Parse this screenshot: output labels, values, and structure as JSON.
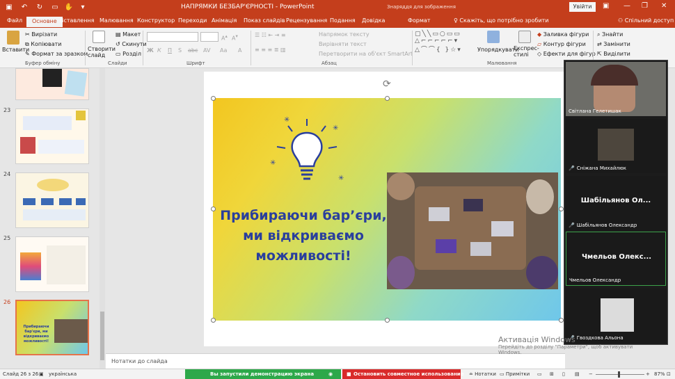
{
  "titlebar": {
    "doc_title": "НАПРЯМКИ БЕЗБАР'ЄРНОСТІ  -  PowerPoint",
    "tools_title": "Знаряддя для зображення",
    "signin": "Увійти"
  },
  "tabs": [
    "Файл",
    "Основне",
    "Вставлення",
    "Малювання",
    "Конструктор",
    "Переходи",
    "Анімація",
    "Показ слайдів",
    "Рецензування",
    "Подання",
    "Довідка",
    "Формат"
  ],
  "tellme": "Скажіть, що потрібно зробити",
  "share": "Спільний доступ",
  "ribbon": {
    "clipboard": {
      "paste": "Вставити",
      "cut": "Вирізати",
      "copy": "Копіювати",
      "format_painter": "Формат за зразком",
      "label": "Буфер обміну"
    },
    "slides": {
      "new_slide": "Створити слайд",
      "layout": "Макет",
      "reset": "Скинути",
      "section": "Розділ",
      "label": "Слайди"
    },
    "font": {
      "label": "Шрифт",
      "buttons": [
        "Ж",
        "К",
        "П",
        "S",
        "abc",
        "AV",
        "Aa",
        "A"
      ]
    },
    "paragraph": {
      "text_direction": "Напрямок тексту",
      "align_text": "Вирівняти текст",
      "smartart": "Перетворити на об'єкт SmartArt",
      "label": "Абзац"
    },
    "drawing": {
      "arrange": "Упорядкувати",
      "quick_styles": "Експрес-стилі",
      "fill": "Заливка фігури",
      "outline": "Контур фігури",
      "effects": "Ефекти для фігур",
      "label": "Малювання"
    },
    "editing": {
      "find": "Знайти",
      "replace": "Замінити",
      "select": "Виділити"
    }
  },
  "slides": {
    "numbers": [
      "23",
      "24",
      "25",
      "26"
    ],
    "thumb26_text": "Прибираючи бар'єри, ми відкриваємо можливості!"
  },
  "slide": {
    "headline": [
      "Прибираючи бар’єри,",
      "ми відкриваємо",
      "можливості!"
    ]
  },
  "notes_placeholder": "Нотатки до слайда",
  "statusbar": {
    "slide_count": "Слайд 26 з 26",
    "language": "українська",
    "demo_notice": "Вы запустили демонстрацию экрана",
    "stop_sharing": "Остановить совместное использование",
    "notes": "Нотатки",
    "comments": "Примітки",
    "zoom": "87%"
  },
  "video": {
    "participants": [
      {
        "name": "Світлана Гелетишак",
        "big": ""
      },
      {
        "name": "Сніжана Михайлюк",
        "big": ""
      },
      {
        "name": "Шабільянов Олександр",
        "big": "Шабільянов Ол..."
      },
      {
        "name": "Чмельов Олександр",
        "big": "Чмельов Олекс..."
      },
      {
        "name": "Гвоздкова Альона",
        "big": ""
      }
    ]
  },
  "activation": {
    "title": "Активація Windows",
    "line1": "Перейдіть до розділу \"Параметри\", щоб активувати",
    "line2": "Windows."
  },
  "colors": {
    "accent": "#c43e1c",
    "headline": "#2a3f9d",
    "demo": "#2da84a",
    "stop": "#d92b2b"
  }
}
